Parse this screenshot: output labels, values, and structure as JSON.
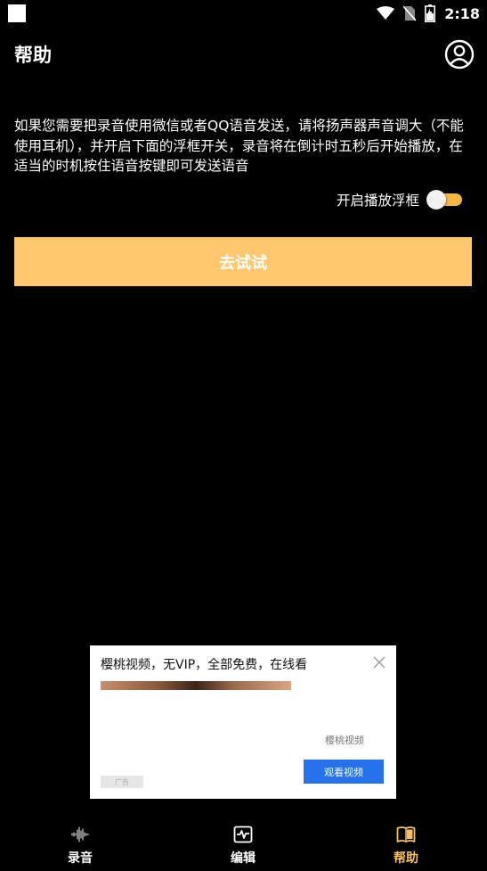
{
  "status_bar": {
    "time": "2:18"
  },
  "header": {
    "title": "帮助"
  },
  "help": {
    "text": "如果您需要把录音使用微信或者QQ语音发送，请将扬声器声音调大（不能使用耳机），并开启下面的浮框开关，录音将在倒计时五秒后开始播放，在适当的时机按住语音按键即可发送语音",
    "toggle_label": "开启播放浮框",
    "toggle_on": true,
    "try_button": "去试试"
  },
  "ad": {
    "title": "樱桃视频，无VIP，全部免费，在线看",
    "brand": "樱桃视频",
    "cta": "观看视频",
    "badge": "广告"
  },
  "colors": {
    "accent": "#ffc76e",
    "toggle": "#f5b942",
    "active_nav": "#f7c064",
    "ad_button": "#2672ec"
  },
  "nav": {
    "items": [
      {
        "label": "录音",
        "icon": "waveform-icon"
      },
      {
        "label": "编辑",
        "icon": "pulse-chart-icon"
      },
      {
        "label": "帮助",
        "icon": "book-icon",
        "active": true
      }
    ]
  }
}
